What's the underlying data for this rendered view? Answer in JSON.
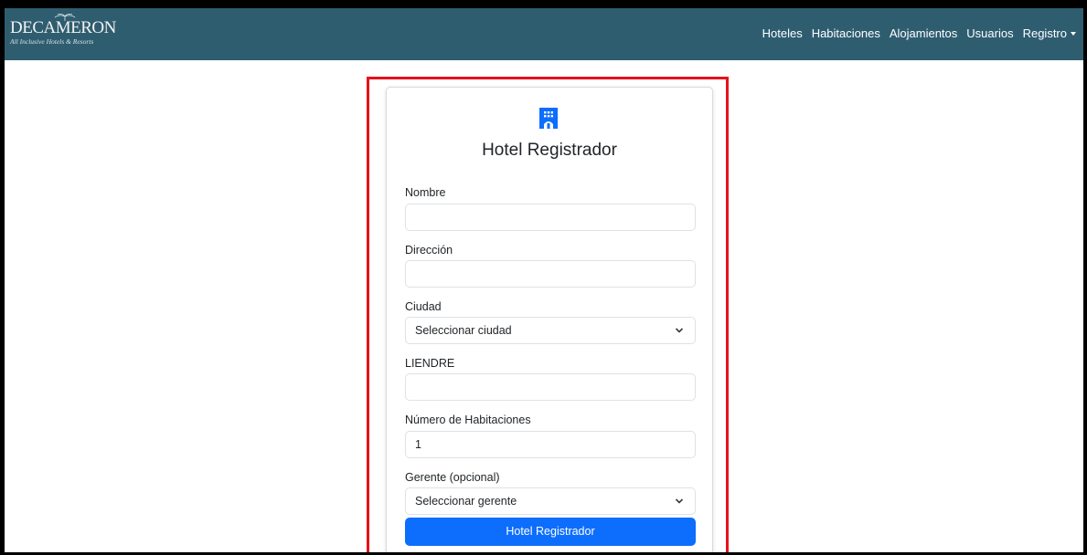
{
  "brand": {
    "name": "DECAMERON",
    "tagline": "All Inclusive Hotels & Resorts"
  },
  "nav": {
    "items": [
      "Hoteles",
      "Habitaciones",
      "Alojamientos",
      "Usuarios",
      "Registro"
    ]
  },
  "form": {
    "title": "Hotel Registrador",
    "fields": {
      "nombre": {
        "label": "Nombre",
        "value": ""
      },
      "direccion": {
        "label": "Dirección",
        "value": ""
      },
      "ciudad": {
        "label": "Ciudad",
        "selected": "Seleccionar ciudad"
      },
      "liendre": {
        "label": "LIENDRE",
        "value": ""
      },
      "habitaciones": {
        "label": "Número de Habitaciones",
        "value": "1"
      },
      "gerente": {
        "label": "Gerente (opcional)",
        "selected": "Seleccionar gerente"
      }
    },
    "submit_label": "Hotel Registrador"
  },
  "colors": {
    "navbar": "#2f5d70",
    "primary": "#0d6efd",
    "highlight": "#e8101a"
  }
}
